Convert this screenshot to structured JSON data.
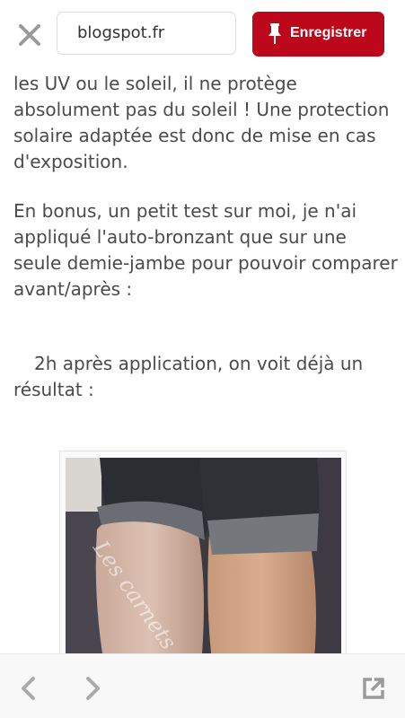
{
  "header": {
    "close_icon": "close-icon",
    "url": "blogspot.fr",
    "save_label": "Enregistrer",
    "save_icon": "pin-icon",
    "accent_color": "#bd081c"
  },
  "article": {
    "para1": "les UV ou le soleil, il ne protège absolument pas du soleil ! Une protection solaire adaptée est donc de mise en cas d'exposition.",
    "para2": "En bonus, un petit test sur moi, je n'ai appliqué l'auto-bronzant que sur une seule demie-jambe pour pouvoir comparer avant/après :",
    "para3": "2h après application, on voit déjà un résultat :",
    "photo_watermark": "Les carnets"
  },
  "footer": {
    "back_icon": "chevron-left-icon",
    "forward_icon": "chevron-right-icon",
    "open_external_icon": "open-external-icon"
  }
}
